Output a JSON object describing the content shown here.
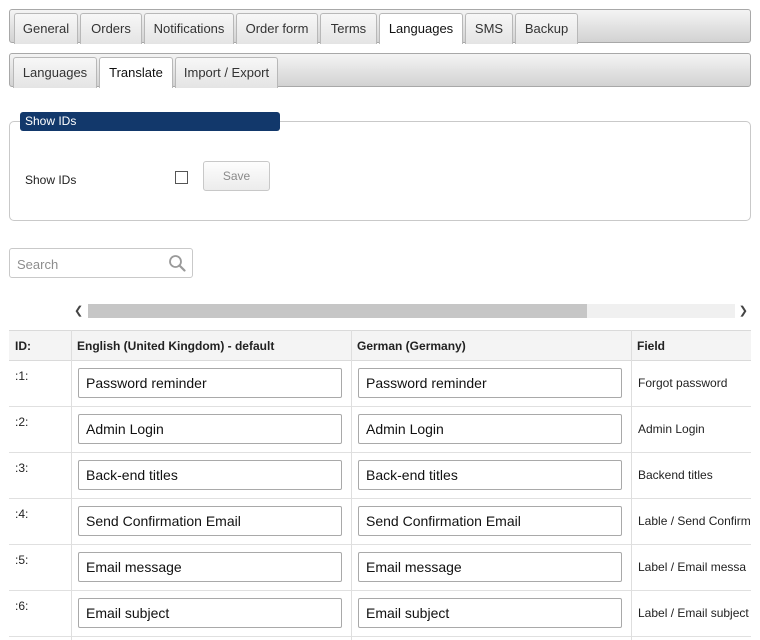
{
  "main_tabs": [
    {
      "label": "General",
      "active": false
    },
    {
      "label": "Orders",
      "active": false
    },
    {
      "label": "Notifications",
      "active": false
    },
    {
      "label": "Order form",
      "active": false
    },
    {
      "label": "Terms",
      "active": false
    },
    {
      "label": "Languages",
      "active": true
    },
    {
      "label": "SMS",
      "active": false
    },
    {
      "label": "Backup",
      "active": false
    }
  ],
  "sub_tabs": [
    {
      "label": "Languages",
      "active": false
    },
    {
      "label": "Translate",
      "active": true
    },
    {
      "label": "Import / Export",
      "active": false
    }
  ],
  "show_ids": {
    "legend": "Show IDs",
    "label": "Show IDs",
    "checked": false,
    "save_label": "Save"
  },
  "search": {
    "placeholder": "Search",
    "icon": "search-icon"
  },
  "table": {
    "columns": [
      "ID:",
      "English (United Kingdom) - default",
      "German (Germany)",
      "Field"
    ],
    "rows": [
      {
        "id": ":1:",
        "english": "Password reminder",
        "german": "Password reminder",
        "field": "Forgot password"
      },
      {
        "id": ":2:",
        "english": "Admin Login",
        "german": "Admin Login",
        "field": "Admin Login"
      },
      {
        "id": ":3:",
        "english": "Back-end titles",
        "german": "Back-end titles",
        "field": "Backend titles"
      },
      {
        "id": ":4:",
        "english": "Send Confirmation Email",
        "german": "Send Confirmation Email",
        "field": "Lable / Send Confirm"
      },
      {
        "id": ":5:",
        "english": "Email message",
        "german": "Email message",
        "field": "Label / Email messa"
      },
      {
        "id": ":6:",
        "english": "Email subject",
        "german": "Email subject",
        "field": "Label / Email subject"
      }
    ]
  },
  "colors": {
    "legend_bg": "#12386b",
    "active_tab_bg": "#ffffff"
  }
}
